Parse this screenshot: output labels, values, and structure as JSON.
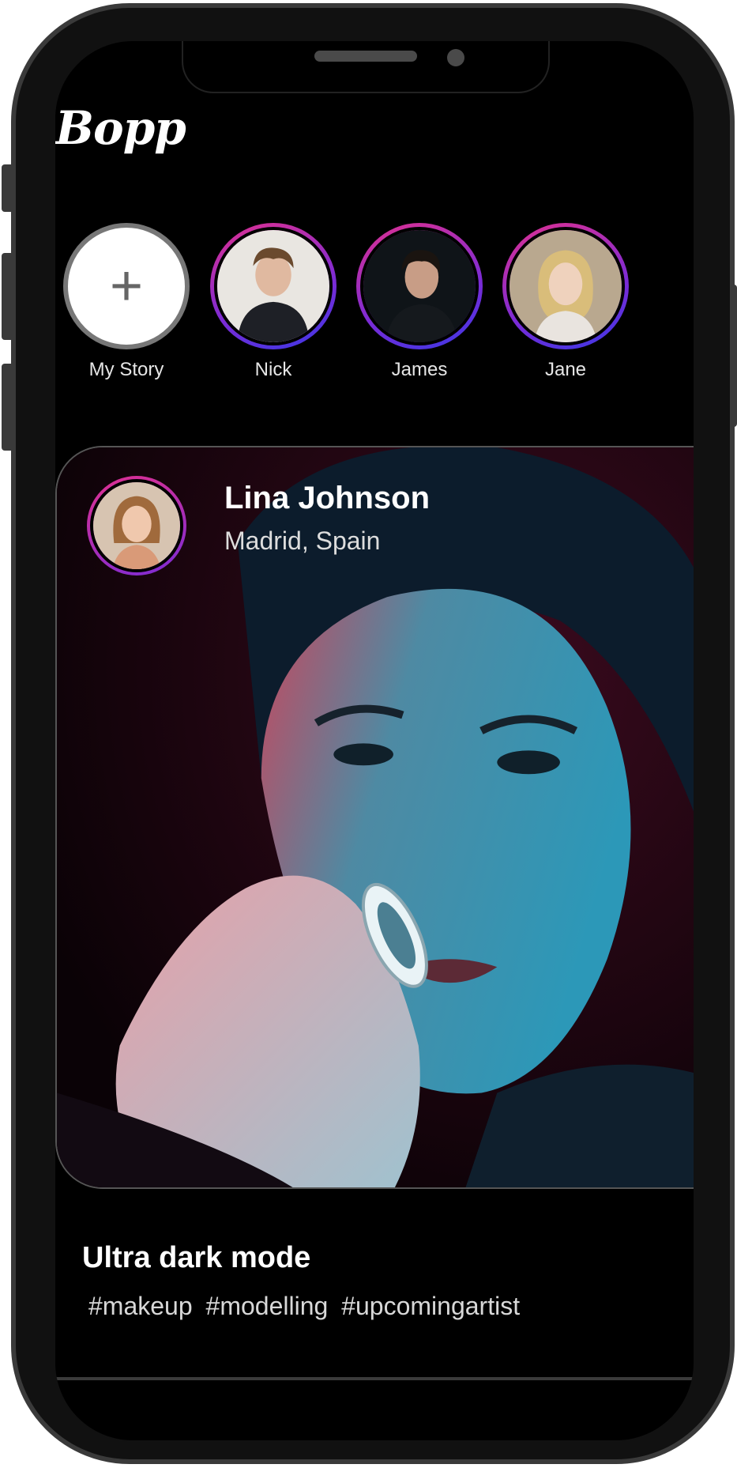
{
  "app": {
    "logo": "Bopp"
  },
  "stories": [
    {
      "label": "My Story",
      "type": "add",
      "icon": "plus-icon"
    },
    {
      "label": "Nick",
      "type": "user"
    },
    {
      "label": "James",
      "type": "user"
    },
    {
      "label": "Jane",
      "type": "user"
    }
  ],
  "post": {
    "author_name": "Lina Johnson",
    "author_location": "Madrid, Spain",
    "caption": "Ultra dark mode",
    "tags": "#makeup #modelling #upcomingartist"
  },
  "colors": {
    "background": "#000000",
    "ring_start": "#e0308f",
    "ring_end": "#3a38e6"
  }
}
